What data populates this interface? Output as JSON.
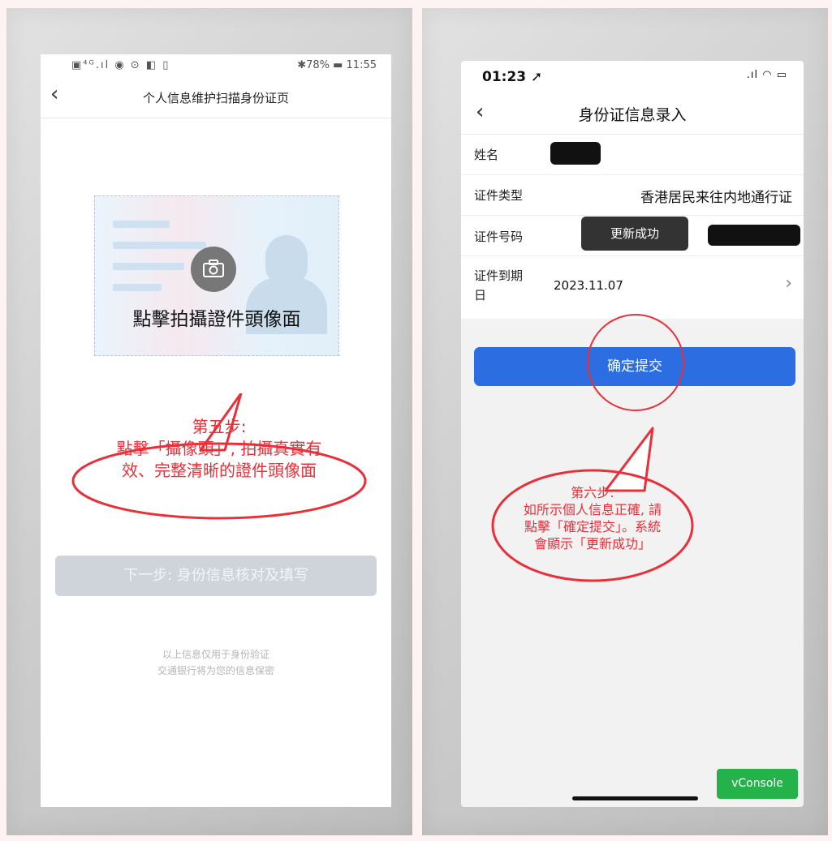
{
  "left_phone": {
    "status_bar": {
      "icons": "▣⁴ᴳ.ıl ◉ ⊙ ◧ ▯",
      "right": "✱78% ▬ 11:55"
    },
    "title": "个人信息维护扫描身份证页",
    "id_capture_label": "點擊拍攝證件頭像面",
    "annotation": {
      "line1": "第五步:",
      "line2": "點擊「攝像頭」, 拍攝真實有",
      "line3": "效、完整清晰的證件頭像面"
    },
    "next_button": "下一步: 身份信息核对及填写",
    "footer_line1": "以上信息仅用于身份验证",
    "footer_line2": "交通银行将为您的信息保密"
  },
  "right_phone": {
    "status_bar": {
      "time": "01:23 ➚",
      "icons": ".ıl ◠ ▭"
    },
    "title": "身份证信息录入",
    "fields": {
      "name_label": "姓名",
      "id_type_label": "证件类型",
      "id_type_value": "香港居民来往内地通行证",
      "id_number_label": "证件号码",
      "expiry_label_line1": "证件到期",
      "expiry_label_line2": "日",
      "expiry_value": "2023.11.07"
    },
    "toast": "更新成功",
    "submit_button": "确定提交",
    "annotation": {
      "line1": "第六步:",
      "line2": "如所示個人信息正確, 請",
      "line3": "點擊「確定提交」。系統",
      "line4": "會顯示「更新成功」"
    },
    "vconsole": "vConsole"
  },
  "colors": {
    "annotation_red": "#e8303a",
    "submit_blue": "#2c6ee2",
    "vconsole_green": "#25b24a"
  }
}
